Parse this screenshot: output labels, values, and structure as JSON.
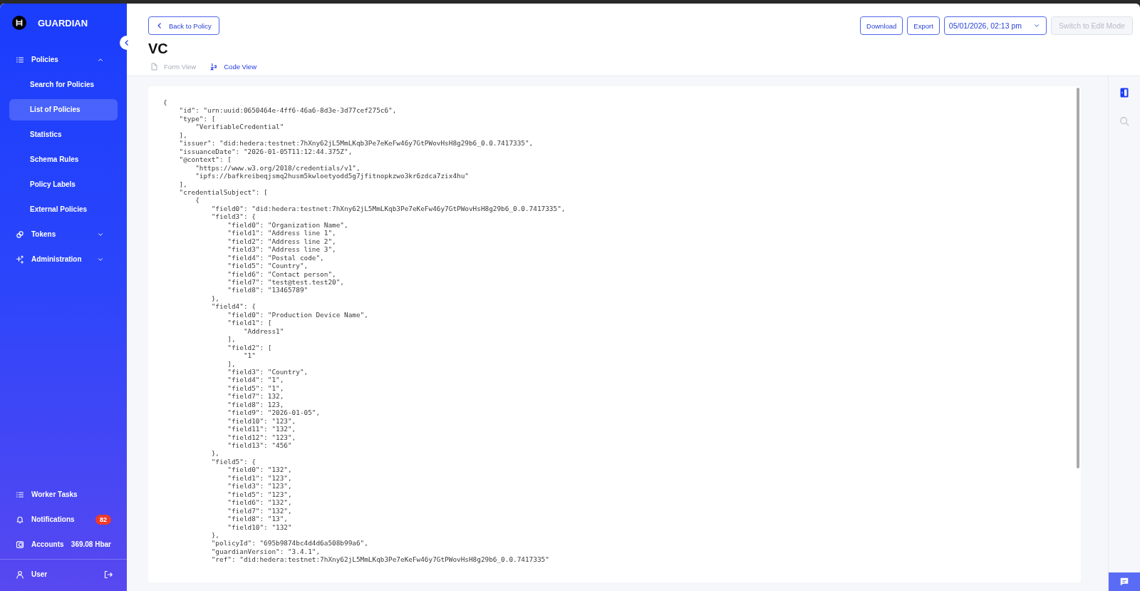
{
  "sidebar": {
    "brand": "GUARDIAN",
    "nav": [
      {
        "label": "Policies",
        "expanded": true,
        "children": [
          {
            "label": "Search for Policies",
            "selected": false
          },
          {
            "label": "List of Policies",
            "selected": true
          },
          {
            "label": "Statistics",
            "selected": false
          },
          {
            "label": "Schema Rules",
            "selected": false
          },
          {
            "label": "Policy Labels",
            "selected": false
          },
          {
            "label": "External Policies",
            "selected": false
          }
        ]
      },
      {
        "label": "Tokens",
        "expanded": false
      },
      {
        "label": "Administration",
        "expanded": false
      }
    ],
    "footer": [
      {
        "label": "Worker Tasks"
      },
      {
        "label": "Notifications",
        "badge": "82"
      },
      {
        "label": "Accounts",
        "value": "369.08 Hbar"
      }
    ],
    "user": "User"
  },
  "header": {
    "back_button": "Back to Policy",
    "actions": [
      "Download",
      "Export"
    ],
    "version_select": {
      "value": "05/01/2026, 02:13 pm"
    },
    "edit_button": {
      "label": "Switch to Edit Mode",
      "disabled": true
    },
    "title": "VC",
    "view_tabs": [
      {
        "label": "Form View",
        "selected": false
      },
      {
        "label": "Code View",
        "selected": true
      }
    ]
  },
  "code": {
    "lines": [
      "{",
      "    \"id\": \"urn:uuid:0650464e-4ff6-46a6-8d3e-3d77cef275c6\",",
      "    \"type\": [",
      "        \"VerifiableCredential\"",
      "    ],",
      "    \"issuer\": \"did:hedera:testnet:7hXny62jL5MmLKqb3Pe7eKeFw46y7GtPWovHsH8g29b6_0.0.7417335\",",
      "    \"issuanceDate\": \"2026-01-05T11:12:44.375Z\",",
      "    \"@context\": [",
      "        \"https://www.w3.org/2018/credentials/v1\",",
      "        \"ipfs://bafkreibeqjsmq2husm5kwloetyodd5g7jfitnopkzwo3kr6zdca7zix4hu\"",
      "    ],",
      "    \"credentialSubject\": [",
      "        {",
      "            \"field0\": \"did:hedera:testnet:7hXny62jL5MmLKqb3Pe7eKeFw46y7GtPWovHsH8g29b6_0.0.7417335\",",
      "            \"field3\": {",
      "                \"field0\": \"Organization Name\",",
      "                \"field1\": \"Address line 1\",",
      "                \"field2\": \"Address line 2\",",
      "                \"field3\": \"Address line 3\",",
      "                \"field4\": \"Postal code\",",
      "                \"field5\": \"Country\",",
      "                \"field6\": \"Contact person\",",
      "                \"field7\": \"test@test.test20\",",
      "                \"field8\": \"13465789\"",
      "            },",
      "            \"field4\": {",
      "                \"field0\": \"Production Device Name\",",
      "                \"field1\": [",
      "                    \"Address1\"",
      "                ],",
      "                \"field2\": [",
      "                    \"1\"",
      "                ],",
      "                \"field3\": \"Country\",",
      "                \"field4\": \"1\",",
      "                \"field5\": \"1\",",
      "                \"field7\": 132,",
      "                \"field8\": 123,",
      "                \"field9\": \"2026-01-05\",",
      "                \"field10\": \"123\",",
      "                \"field11\": \"132\",",
      "                \"field12\": \"123\",",
      "                \"field13\": \"456\"",
      "            },",
      "            \"field5\": {",
      "                \"field0\": \"132\",",
      "                \"field1\": \"123\",",
      "                \"field3\": \"123\",",
      "                \"field5\": \"123\",",
      "                \"field6\": \"132\",",
      "                \"field7\": \"132\",",
      "                \"field8\": \"13\",",
      "                \"field10\": \"132\"",
      "            },",
      "            \"policyId\": \"695b9874bc4d4d6a508b99a6\",",
      "            \"guardianVersion\": \"3.4.1\",",
      "            \"ref\": \"did:hedera:testnet:7hXny62jL5MmLKqb3Pe7eKeFw46y7GtPWovHsH8g29b6_0.0.7417335\""
    ]
  }
}
